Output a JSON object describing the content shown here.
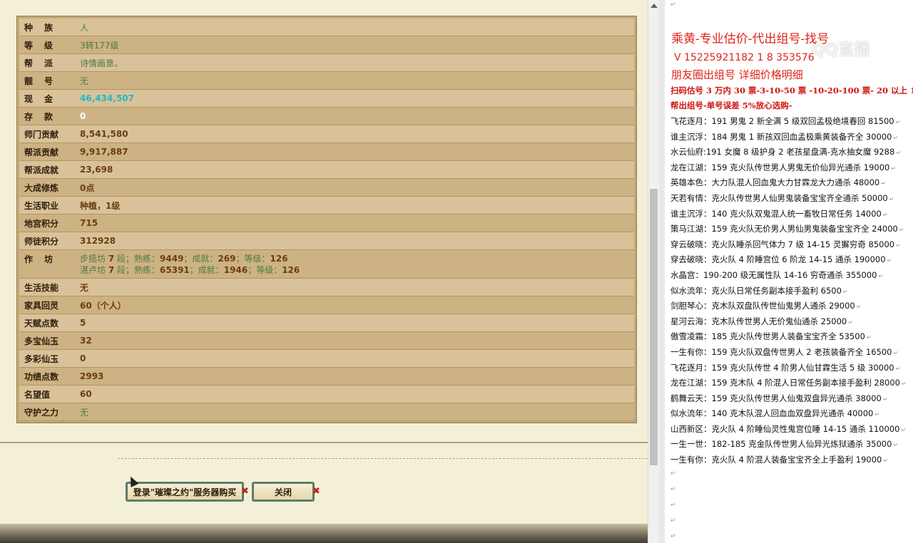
{
  "game_panel": {
    "rows": [
      {
        "label": "种族",
        "value": "人",
        "style": "green",
        "spread": true
      },
      {
        "label": "等级",
        "value": "3转177级",
        "style": "green",
        "spread": true
      },
      {
        "label": "帮派",
        "value": "诗情画意。",
        "style": "green",
        "spread": true
      },
      {
        "label": "靓号",
        "value": "无",
        "style": "green",
        "spread": true
      },
      {
        "label": "现金",
        "value": "46,434,507",
        "style": "cyan",
        "spread": true
      },
      {
        "label": "存款",
        "value": "0",
        "style": "white",
        "spread": true
      },
      {
        "label": "师门贡献",
        "value": "8,541,580",
        "style": "num"
      },
      {
        "label": "帮派贡献",
        "value": "9,917,887",
        "style": "num"
      },
      {
        "label": "帮派成就",
        "value": "23,698",
        "style": "num"
      },
      {
        "label": "大成修炼",
        "value": "0点",
        "style": "num"
      },
      {
        "label": "生活职业",
        "value": "种植，1级",
        "style": "num"
      },
      {
        "label": "地宫积分",
        "value": "715",
        "style": "num"
      },
      {
        "label": "师徒积分",
        "value": "312928",
        "style": "num"
      }
    ],
    "workshop": {
      "label": "作坊",
      "lines": [
        {
          "prefix": "步摇坊 ",
          "tier": "7",
          "t1": " 段；熟练：",
          "skill": "9449",
          "t2": "；成就：",
          "ach": "269",
          "t3": "；等级：",
          "lvl": "126"
        },
        {
          "prefix": "湛卢坊 ",
          "tier": "7",
          "t1": " 段；熟练：",
          "skill": "65391",
          "t2": "；成就：",
          "ach": "1946",
          "t3": "；等级：",
          "lvl": "126"
        }
      ]
    },
    "rows2": [
      {
        "label": "生活技能",
        "value": "无",
        "style": "num"
      },
      {
        "label": "家具回灵",
        "value": "60（个人）",
        "style": "num"
      },
      {
        "label": "天赋点数",
        "value": "5",
        "style": "num"
      },
      {
        "label": "多宝仙玉",
        "value": "32",
        "style": "num"
      },
      {
        "label": "多彩仙玉",
        "value": "0",
        "style": "num"
      },
      {
        "label": "功绩点数",
        "value": "2993",
        "style": "num"
      },
      {
        "label": "名望值",
        "value": "60",
        "style": "num"
      },
      {
        "label": "守护之力",
        "value": "无",
        "style": "green"
      }
    ],
    "buy_button_label": "登录\"璀璨之约\"服务器购买",
    "close_button_label": "关闭",
    "x_mark": "✖"
  },
  "doc": {
    "title": "乘黄-专业估价-代出组号-找号",
    "contact": "V 15225921182   1   8  353576",
    "moments": "朋友圈出组号    详细价格明细",
    "red_line_1": "扫码估号 3 万内 30 票-3-10-50 票  -10-20-100 票- 20 以上 150",
    "red_line_2": "帮出组号-单号误差 5%放心选购-",
    "watermark": "QQ直播",
    "listings": [
      "飞花逐月：191 男鬼 2 新全满 5 级双回孟极绝境春回 81500",
      "谁主沉浮：184 男鬼 1 新孩双回血孟极乘黄装备齐全 30000",
      "水云仙府:191 女魔 8 级护身 2 老孩星盘满-克水抽女魔 9288",
      "龙在江湖：159 克火队传世男人男鬼无价仙异光通杀 19000",
      "英雄本色：大力队混人回血鬼大力甘霖龙大力通杀 48000",
      "天若有情：克火队传世男人仙男鬼装备宝宝齐全通杀 50000",
      "谁主沉浮：140 克火队双鬼混人统一畜牧日常任务 14000",
      "策马江湖：159 克火队无价男人男仙男鬼装备宝宝齐全 24000",
      "穿云破晓：克火队睡杀回气体力 7 级 14-15 灵獬穷奇 85000",
      "穿去破晓：克火队 4 阶睡宫位 6 阶龙 14-15 通杀 190000",
      "水晶宫：190-200 级无属性队 14-16 穷奇通杀 355000",
      "似水流年：克火队日常任务副本接手盈利 6500",
      "剑胆琴心：克木队双盘队传世仙鬼男人通杀 29000",
      "星河云海：克木队传世男人无价鬼仙通杀 25000",
      "傲雪凌霜：185 克火队传世男人装备宝宝齐全 53500",
      "一生有你：159 克火队双盘传世男人 2 老孩装备齐全 16500",
      "飞花逐月：159 克火队传世 4 阶男人仙甘霖生活 5 级 30000",
      "龙在江湖：159 克木队 4 阶混人日常任务副本接手盈利 28000",
      "鹤舞云天：159 克火队传世男人仙鬼双盘异光通杀 38000",
      "似水流年：140 克木队混人回血血双盘异光通杀 40000",
      "山西新区：克火队 4 阶睡仙灵性鬼宫位睡 14-15 通杀 110000",
      "一生一世：182-185 克金队传世男人仙异光炼狱通杀 35000",
      "一生有你：克火队 4 阶混人装备宝宝齐全上手盈利 19000"
    ],
    "para_mark": "↵"
  }
}
